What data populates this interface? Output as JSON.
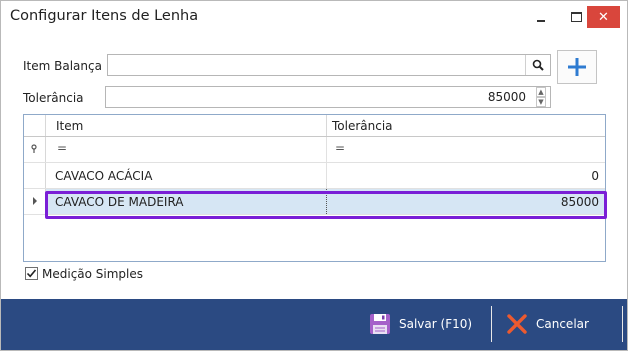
{
  "window": {
    "title": "Configurar Itens de Lenha",
    "controls": [
      "minimize",
      "maximize",
      "close"
    ],
    "close_color": "#d9463c"
  },
  "form": {
    "item_balanca_label": "Item Balança",
    "item_balanca_value": "",
    "tolerancia_label": "Tolerância",
    "tolerancia_value": "85000"
  },
  "grid": {
    "columns": [
      "Item",
      "Tolerância"
    ],
    "filter_symbol": "=",
    "filter_pin_icon": "pin-icon",
    "rows": [
      {
        "item": "CAVACO ACÁCIA",
        "tolerancia": "0",
        "selected": false
      },
      {
        "item": "CAVACO DE MADEIRA",
        "tolerancia": "85000",
        "selected": true
      }
    ],
    "selection_highlight_color": "#7a1fd6"
  },
  "options": {
    "medicao_simples_label": "Medição Simples",
    "medicao_simples_checked": true
  },
  "footer": {
    "background": "#2b4a82",
    "save_label": "Salvar (F10)",
    "cancel_label": "Cancelar",
    "save_icon": "floppy-disk-icon",
    "cancel_icon": "red-x-icon"
  }
}
